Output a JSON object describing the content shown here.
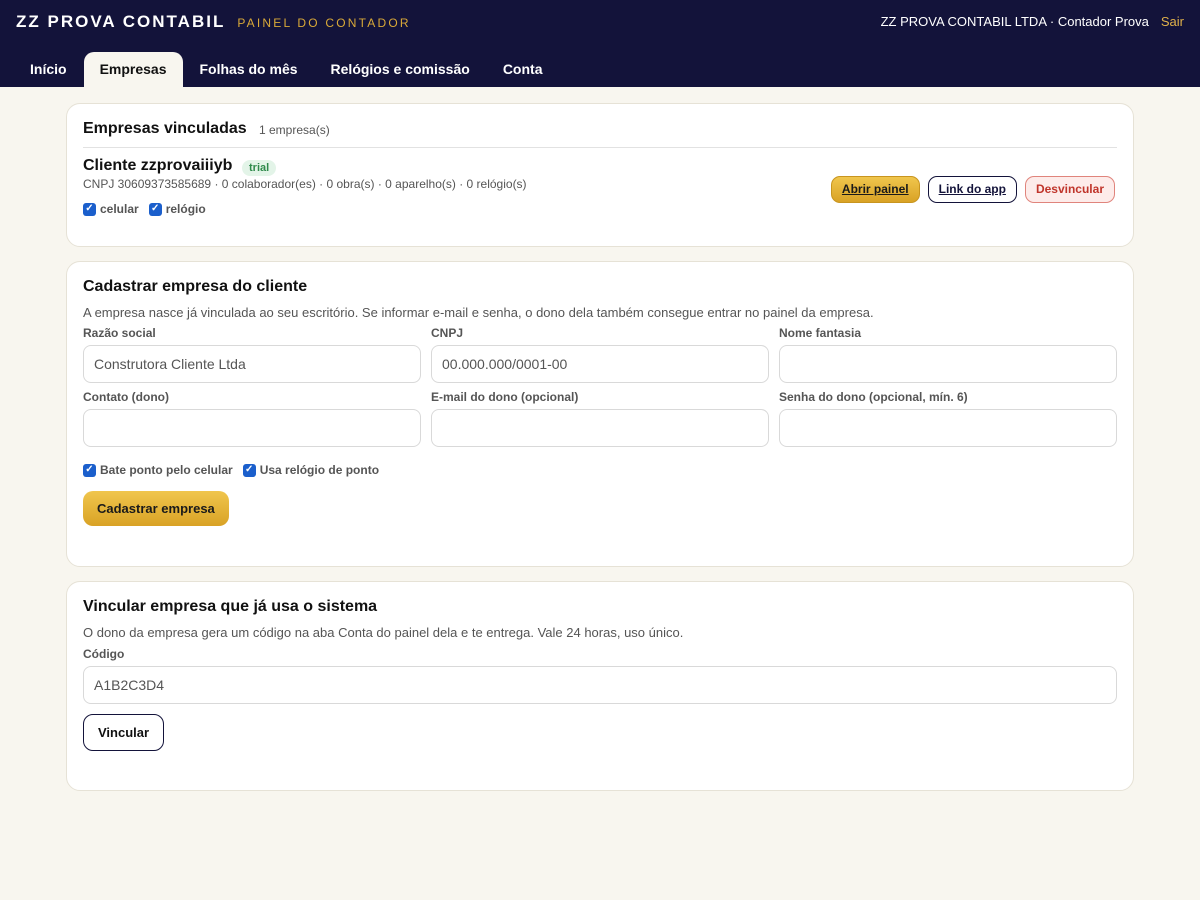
{
  "header": {
    "brand": "ZZ PROVA CONTABIL",
    "subtitle": "PAINEL DO CONTADOR",
    "user": "ZZ PROVA CONTABIL LTDA · Contador Prova",
    "logout": "Sair"
  },
  "tabs": [
    {
      "label": "Início",
      "active": false
    },
    {
      "label": "Empresas",
      "active": true
    },
    {
      "label": "Folhas do mês",
      "active": false
    },
    {
      "label": "Relógios e comissão",
      "active": false
    },
    {
      "label": "Conta",
      "active": false
    }
  ],
  "linked": {
    "title": "Empresas vinculadas",
    "count": "1 empresa(s)",
    "company": {
      "name": "Cliente zzprovaiiiyb",
      "badge": "trial",
      "meta": "CNPJ 30609373585689 · 0 colaborador(es) · 0 obra(s) · 0 aparelho(s) · 0 relógio(s)",
      "flags": [
        {
          "label": "celular",
          "checked": true
        },
        {
          "label": "relógio",
          "checked": true
        }
      ]
    },
    "actions": {
      "open": "Abrir painel",
      "app_link": "Link do app",
      "unlink": "Desvincular"
    }
  },
  "register": {
    "title": "Cadastrar empresa do cliente",
    "description": "A empresa nasce já vinculada ao seu escritório. Se informar e-mail e senha, o dono dela também consegue entrar no painel da empresa.",
    "fields": {
      "razao": {
        "label": "Razão social",
        "placeholder": "Construtora Cliente Ltda",
        "value": ""
      },
      "cnpj": {
        "label": "CNPJ",
        "placeholder": "00.000.000/0001-00",
        "value": ""
      },
      "fantasia": {
        "label": "Nome fantasia",
        "placeholder": "",
        "value": ""
      },
      "contato": {
        "label": "Contato (dono)",
        "placeholder": "",
        "value": ""
      },
      "email": {
        "label": "E-mail do dono (opcional)",
        "placeholder": "",
        "value": ""
      },
      "senha": {
        "label": "Senha do dono (opcional, mín. 6)",
        "placeholder": "",
        "value": ""
      }
    },
    "options": [
      {
        "label": "Bate ponto pelo celular",
        "checked": true
      },
      {
        "label": "Usa relógio de ponto",
        "checked": true
      }
    ],
    "submit": "Cadastrar empresa"
  },
  "link_existing": {
    "title": "Vincular empresa que já usa o sistema",
    "description": "O dono da empresa gera um código na aba Conta do painel dela e te entrega. Vale 24 horas, uso único.",
    "code_label": "Código",
    "code_placeholder": "A1B2C3D4",
    "submit": "Vincular"
  },
  "colors": {
    "navy": "#13133a",
    "gold": "#e0b14a",
    "background": "#f8f6ef",
    "danger": "#c0352b",
    "success": "#2f8a4b",
    "checkbox": "#1b5fcc"
  }
}
